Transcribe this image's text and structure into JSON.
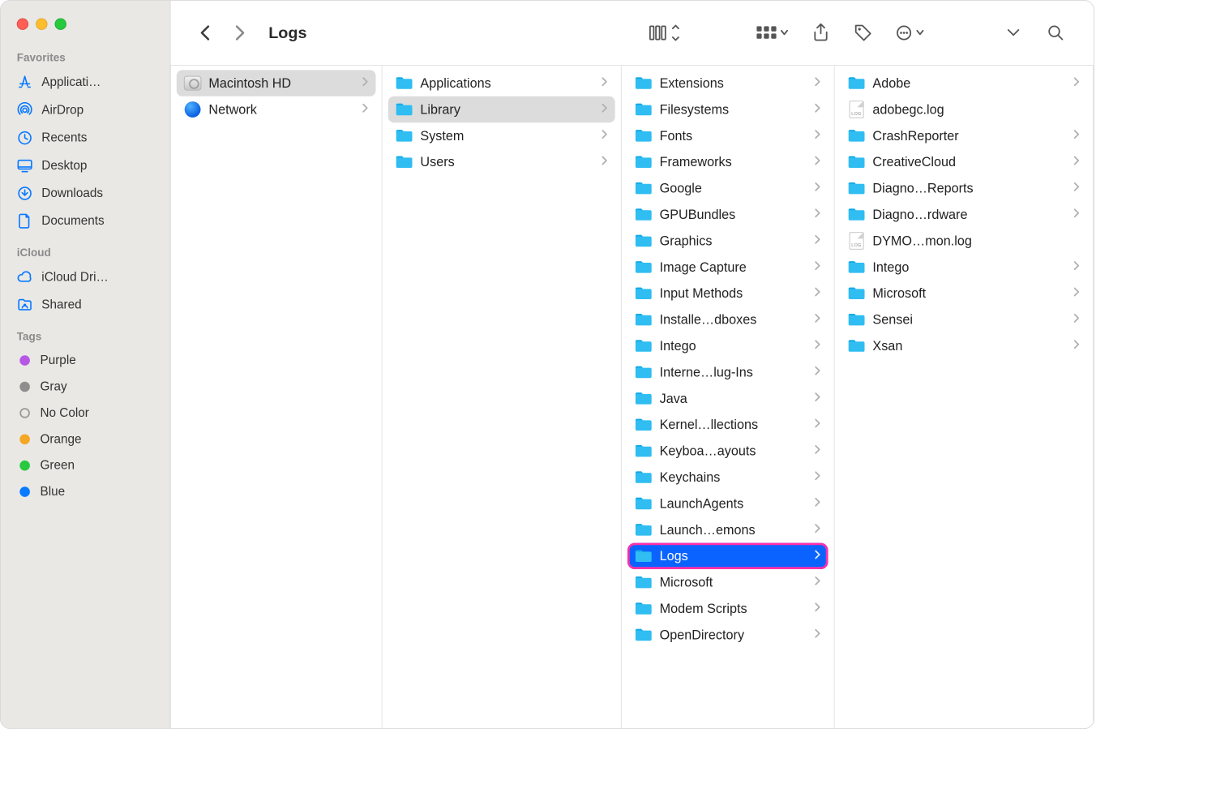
{
  "window": {
    "title": "Logs"
  },
  "sidebar": {
    "sections": {
      "favorites": {
        "header": "Favorites",
        "items": [
          {
            "label": "Applicati…",
            "icon": "appstore"
          },
          {
            "label": "AirDrop",
            "icon": "airdrop"
          },
          {
            "label": "Recents",
            "icon": "clock"
          },
          {
            "label": "Desktop",
            "icon": "desktop"
          },
          {
            "label": "Downloads",
            "icon": "download"
          },
          {
            "label": "Documents",
            "icon": "doc"
          }
        ]
      },
      "icloud": {
        "header": "iCloud",
        "items": [
          {
            "label": "iCloud Dri…",
            "icon": "cloud"
          },
          {
            "label": "Shared",
            "icon": "shared"
          }
        ]
      },
      "tags": {
        "header": "Tags",
        "items": [
          {
            "label": "Purple",
            "color": "#b658e5"
          },
          {
            "label": "Gray",
            "color": "#8e8e8e"
          },
          {
            "label": "No Color",
            "color": "hollow"
          },
          {
            "label": "Orange",
            "color": "#f5a623"
          },
          {
            "label": "Green",
            "color": "#27c93f"
          },
          {
            "label": "Blue",
            "color": "#0a7aff"
          }
        ]
      }
    }
  },
  "columns": [
    {
      "items": [
        {
          "label": "Macintosh HD",
          "kind": "disk",
          "arrow": true,
          "selected": "gray"
        },
        {
          "label": "Network",
          "kind": "globe",
          "arrow": true
        }
      ]
    },
    {
      "items": [
        {
          "label": "Applications",
          "kind": "folder",
          "arrow": true
        },
        {
          "label": "Library",
          "kind": "folder",
          "arrow": true,
          "selected": "gray"
        },
        {
          "label": "System",
          "kind": "folder",
          "arrow": true
        },
        {
          "label": "Users",
          "kind": "folder-people",
          "arrow": true
        }
      ]
    },
    {
      "items": [
        {
          "label": "Extensions",
          "kind": "folder",
          "arrow": true
        },
        {
          "label": "Filesystems",
          "kind": "folder",
          "arrow": true
        },
        {
          "label": "Fonts",
          "kind": "folder",
          "arrow": true
        },
        {
          "label": "Frameworks",
          "kind": "folder",
          "arrow": true
        },
        {
          "label": "Google",
          "kind": "folder",
          "arrow": true
        },
        {
          "label": "GPUBundles",
          "kind": "folder",
          "arrow": true
        },
        {
          "label": "Graphics",
          "kind": "folder",
          "arrow": true
        },
        {
          "label": "Image Capture",
          "kind": "folder",
          "arrow": true
        },
        {
          "label": "Input Methods",
          "kind": "folder",
          "arrow": true
        },
        {
          "label": "Installe…dboxes",
          "kind": "folder",
          "arrow": true
        },
        {
          "label": "Intego",
          "kind": "folder",
          "arrow": true
        },
        {
          "label": "Interne…lug-Ins",
          "kind": "folder",
          "arrow": true
        },
        {
          "label": "Java",
          "kind": "folder",
          "arrow": true
        },
        {
          "label": "Kernel…llections",
          "kind": "folder",
          "arrow": true
        },
        {
          "label": "Keyboa…ayouts",
          "kind": "folder",
          "arrow": true
        },
        {
          "label": "Keychains",
          "kind": "folder",
          "arrow": true
        },
        {
          "label": "LaunchAgents",
          "kind": "folder",
          "arrow": true
        },
        {
          "label": "Launch…emons",
          "kind": "folder",
          "arrow": true
        },
        {
          "label": "Logs",
          "kind": "folder",
          "arrow": true,
          "selected": "blue",
          "highlight": true
        },
        {
          "label": "Microsoft",
          "kind": "folder",
          "arrow": true
        },
        {
          "label": "Modem Scripts",
          "kind": "folder",
          "arrow": true
        },
        {
          "label": "OpenDirectory",
          "kind": "folder",
          "arrow": true
        }
      ]
    },
    {
      "items": [
        {
          "label": "Adobe",
          "kind": "folder",
          "arrow": true
        },
        {
          "label": "adobegc.log",
          "kind": "logfile",
          "arrow": false
        },
        {
          "label": "CrashReporter",
          "kind": "folder",
          "arrow": true
        },
        {
          "label": "CreativeCloud",
          "kind": "folder",
          "arrow": true
        },
        {
          "label": "Diagno…Reports",
          "kind": "folder",
          "arrow": true
        },
        {
          "label": "Diagno…rdware",
          "kind": "folder",
          "arrow": true
        },
        {
          "label": "DYMO…mon.log",
          "kind": "logfile",
          "arrow": false
        },
        {
          "label": "Intego",
          "kind": "folder",
          "arrow": true
        },
        {
          "label": "Microsoft",
          "kind": "folder",
          "arrow": true
        },
        {
          "label": "Sensei",
          "kind": "folder",
          "arrow": true
        },
        {
          "label": "Xsan",
          "kind": "folder",
          "arrow": true
        }
      ]
    }
  ]
}
